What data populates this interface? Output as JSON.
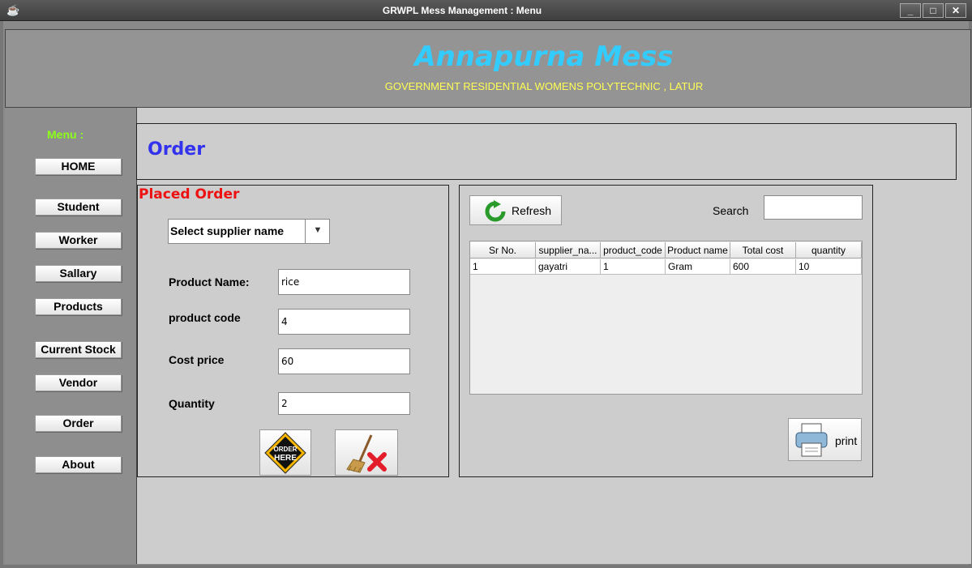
{
  "window": {
    "title": "GRWPL Mess Management  : Menu",
    "minimize": "_",
    "maximize": "□",
    "close": "✕"
  },
  "header": {
    "app_name": "Annapurna Mess",
    "subtitle": "GOVERNMENT RESIDENTIAL WOMENS POLYTECHNIC , LATUR"
  },
  "sidebar": {
    "menu_label": "Menu :",
    "items": [
      {
        "label": "HOME"
      },
      {
        "label": "Student"
      },
      {
        "label": "Worker"
      },
      {
        "label": "Sallary"
      },
      {
        "label": "Products"
      },
      {
        "label": "Current Stock"
      },
      {
        "label": "Vendor"
      },
      {
        "label": "Order"
      },
      {
        "label": "About"
      }
    ]
  },
  "page": {
    "title": "Order"
  },
  "order_form": {
    "title": "Placed Order",
    "supplier_select": "Select supplier name",
    "product_name_label": "Product Name:",
    "product_name_value": "rice",
    "product_code_label": "product code",
    "product_code_value": "4",
    "cost_price_label": "Cost price",
    "cost_price_value": "60",
    "quantity_label": "Quantity",
    "quantity_value": "2",
    "order_button_text": "ORDER HERE"
  },
  "table_panel": {
    "refresh_label": "Refresh",
    "search_label": "Search",
    "search_value": "",
    "print_label": "print",
    "columns": [
      "Sr No.",
      "supplier_na...",
      "product_code",
      "Product name",
      "Total cost",
      "quantity"
    ],
    "rows": [
      [
        "1",
        "gayatri",
        "1",
        "Gram",
        "600",
        "10"
      ]
    ]
  },
  "colors": {
    "app_name": "#33ccff",
    "subtitle": "#ffff55",
    "menu_label": "#8cff1a",
    "page_title": "#3333ee",
    "form_title": "#ee1111",
    "clear_x": "#e31d2a",
    "refresh_green": "#2a9a2a"
  }
}
